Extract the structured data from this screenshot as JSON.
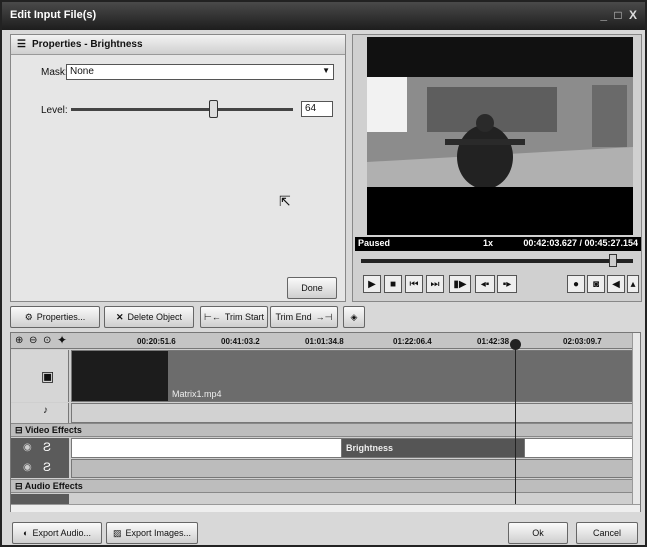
{
  "window": {
    "title": "Edit Input File(s)",
    "controls": "_ □ X"
  },
  "properties": {
    "header": "Properties - Brightness",
    "mask_label": "Mask:",
    "mask_value": "None",
    "level_label": "Level:",
    "level_value": "64",
    "level_fraction": 0.64,
    "done_label": "Done"
  },
  "preview": {
    "status": "Paused",
    "speed": "1x",
    "time": "00:42:03.627 / 00:45:27.154",
    "position_fraction": 0.925
  },
  "toolbar": {
    "properties": "Properties...",
    "delete": "Delete Object",
    "trim_start": "Trim Start",
    "trim_end": "Trim End"
  },
  "timeline": {
    "ticks": [
      "00:20:51.6",
      "00:41:03.2",
      "01:01:34.8",
      "01:22:06.4",
      "01:42:38",
      "02:03:09.7"
    ],
    "clip_name": "Matrix1.mp4",
    "video_effects_label": "Video Effects",
    "effect_name": "Brightness",
    "audio_effects_label": "Audio Effects"
  },
  "footer": {
    "export_audio": "Export Audio...",
    "export_images": "Export Images...",
    "ok": "Ok",
    "cancel": "Cancel"
  }
}
